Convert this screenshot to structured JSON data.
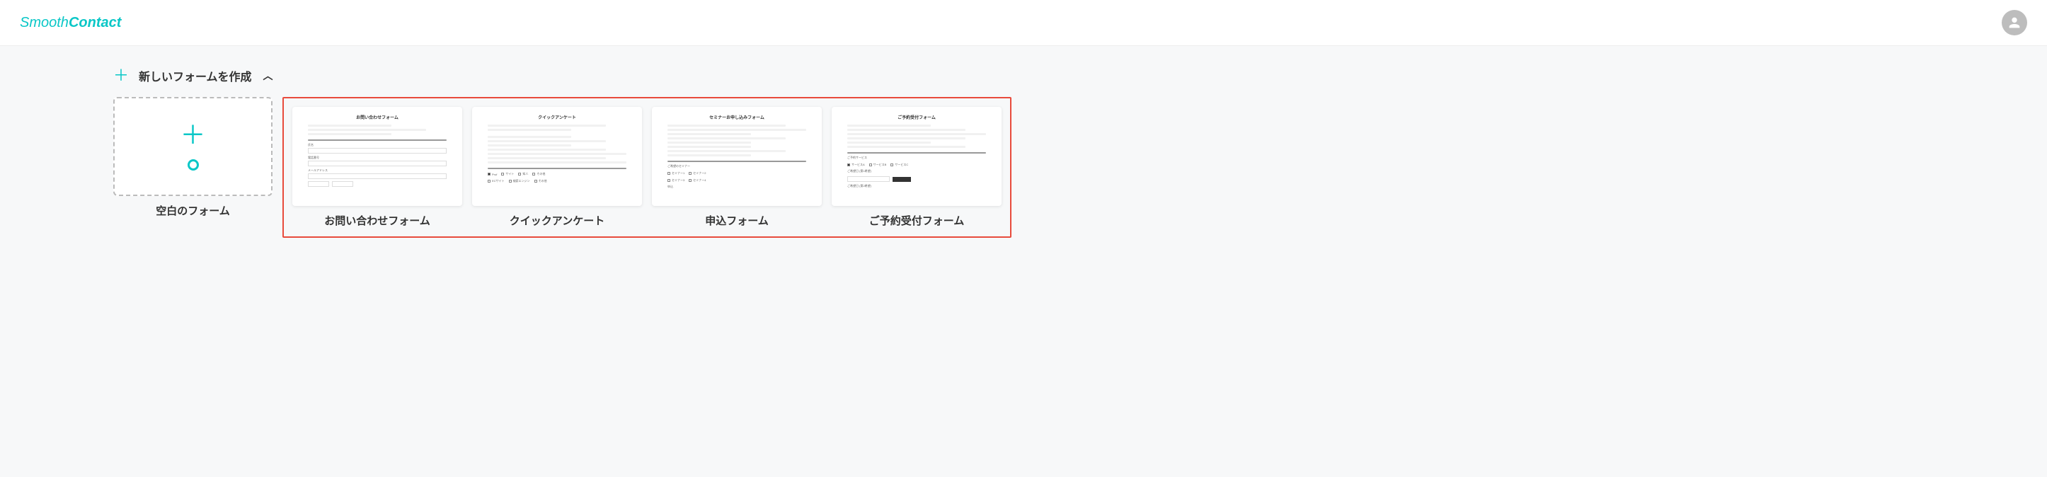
{
  "header": {
    "logo_part1": "Smooth",
    "logo_part2": "Contact"
  },
  "section": {
    "title": "新しいフォームを作成"
  },
  "blank_card": {
    "label": "空白のフォーム"
  },
  "templates": [
    {
      "thumb_title": "お問い合わせフォーム",
      "label": "お問い合わせフォーム"
    },
    {
      "thumb_title": "クイックアンケート",
      "label": "クイックアンケート"
    },
    {
      "thumb_title": "セミナーお申し込みフォーム",
      "label": "申込フォーム"
    },
    {
      "thumb_title": "ご予約受付フォーム",
      "label": "ご予約受付フォーム"
    }
  ]
}
